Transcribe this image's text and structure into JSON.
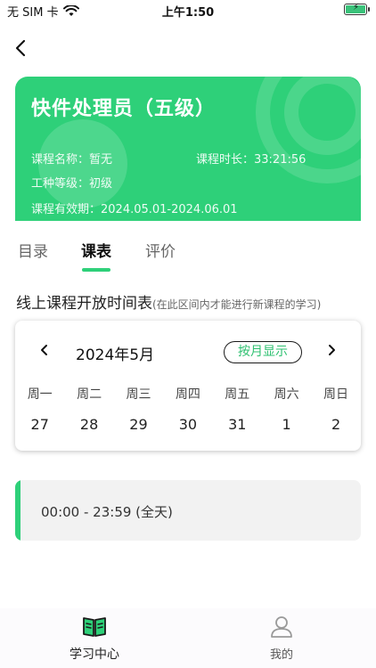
{
  "status_bar": {
    "carrier": "无 SIM 卡",
    "time": "上午1:50"
  },
  "course": {
    "title": "快件处理员（五级）",
    "name_label": "课程名称：暂无",
    "duration_label": "课程时长：33:21:56",
    "level_label": "工种等级：初级",
    "validity_label": "课程有效期：2024.05.01-2024.06.01"
  },
  "tabs": [
    {
      "label": "目录",
      "active": false
    },
    {
      "label": "课表",
      "active": true
    },
    {
      "label": "评价",
      "active": false
    }
  ],
  "schedule": {
    "title": "线上课程开放时间表",
    "note": "(在此区间内才能进行新课程的学习)"
  },
  "calendar": {
    "month": "2024年5月",
    "toggle_label": "按月显示",
    "weekdays": [
      "周一",
      "周二",
      "周三",
      "周四",
      "周五",
      "周六",
      "周日"
    ],
    "days": [
      "27",
      "28",
      "29",
      "30",
      "31",
      "1",
      "2"
    ]
  },
  "time_slot": {
    "text": "00:00 - 23:59 (全天)"
  },
  "bottom_nav": [
    {
      "label": "学习中心",
      "active": true
    },
    {
      "label": "我的",
      "active": false
    }
  ],
  "colors": {
    "accent": "#2ed079",
    "muted": "#b8b8b8"
  }
}
